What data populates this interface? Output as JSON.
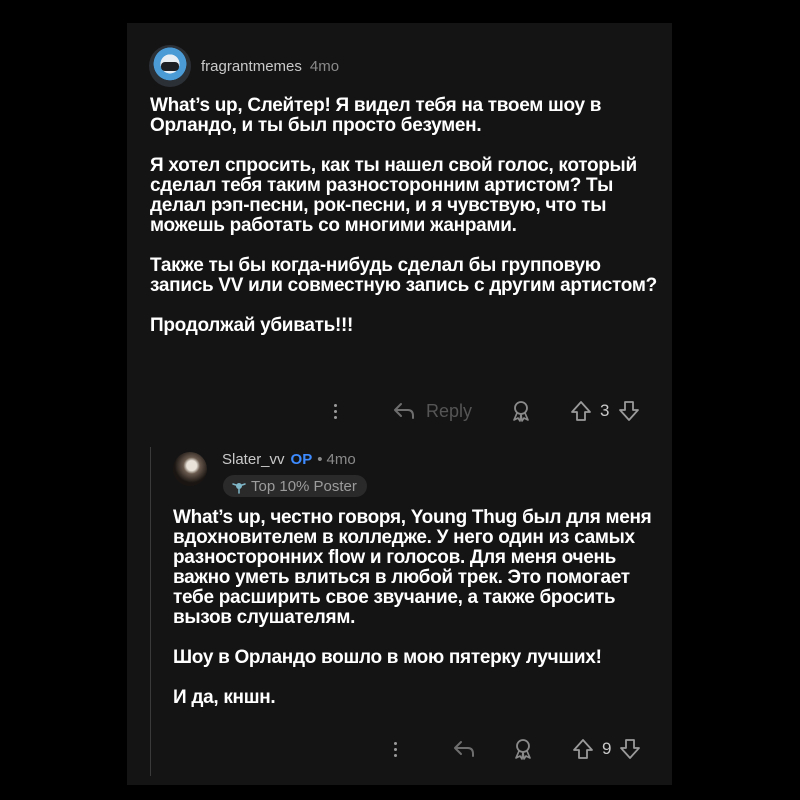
{
  "comment": {
    "username": "fragrantmemes",
    "age": "4mo",
    "paragraphs": [
      "What’s up, Слейтер! Я видел тебя на твоем шоу в Орландо, и ты был просто безумен.",
      "Я хотел спросить, как ты нашел свой голос, который сделал тебя таким разносторонним артистом? Ты делал рэп-песни, рок-песни, и я чувствую, что ты можешь работать со многими жанрами.",
      "Также ты бы когда-нибудь сделал бы групповую запись VV или совместную запись с другим артистом?",
      "Продолжай убивать!!!"
    ],
    "reply_label": "Reply",
    "votes": "3"
  },
  "reply": {
    "username": "Slater_vv",
    "op_badge": "OP",
    "separator": "•",
    "age": "4mo",
    "flair": "Top 10% Poster",
    "paragraphs": [
      "What’s up, честно говоря, Young Thug был для меня вдохновителем в колледже. У него один из самых разносторонних flow и голосов. Для меня очень важно уметь влиться в любой трек. Это помогает тебе расширить свое звучание, а также бросить вызов слушателям.",
      "Шоу в Орландо вошло в мою пятерку лучших!",
      "И да, кншн."
    ],
    "votes": "9"
  },
  "icons": [
    "more-vertical-icon",
    "reply-arrow-icon",
    "award-icon",
    "upvote-icon",
    "downvote-icon",
    "flair-emoji-icon"
  ]
}
